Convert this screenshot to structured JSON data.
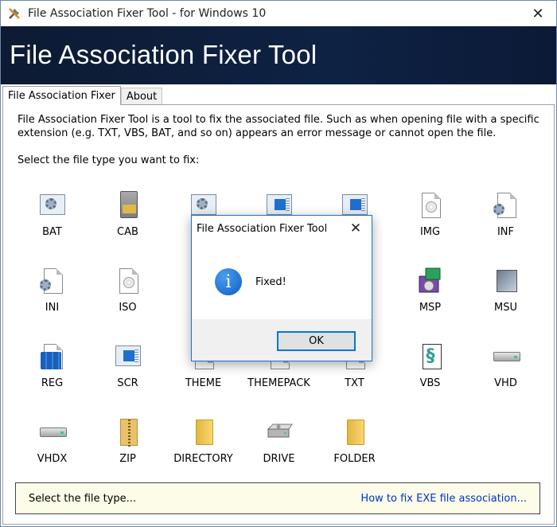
{
  "window": {
    "title": "File Association Fixer Tool - for Windows 10"
  },
  "banner": {
    "title": "File Association Fixer Tool"
  },
  "tabs": [
    {
      "label": "File Association Fixer",
      "active": true
    },
    {
      "label": "About",
      "active": false
    }
  ],
  "main": {
    "description": "File Association Fixer Tool is a tool to fix the associated file. Such as when opening file with a specific extension (e.g. TXT, VBS, BAT, and so on) appears an error message or cannot open the file.",
    "prompt": "Select the file type you want to fix:",
    "file_types": [
      {
        "label": "BAT",
        "icon": "batch-icon"
      },
      {
        "label": "CAB",
        "icon": "cabinet-icon"
      },
      {
        "label": "",
        "icon": "gear-window-icon"
      },
      {
        "label": "",
        "icon": "window-icon"
      },
      {
        "label": "",
        "icon": "window-icon"
      },
      {
        "label": "IMG",
        "icon": "disc-image-icon"
      },
      {
        "label": "INF",
        "icon": "gear-document-icon"
      },
      {
        "label": "INI",
        "icon": "gear-document-icon"
      },
      {
        "label": "ISO",
        "icon": "disc-image-icon"
      },
      {
        "label": "MSP",
        "icon": "installer-icon"
      },
      {
        "label": "MSU",
        "icon": "update-package-icon"
      },
      {
        "label": "REG",
        "icon": "registry-icon"
      },
      {
        "label": "SCR",
        "icon": "window-icon"
      },
      {
        "label": "THEME",
        "icon": "theme-icon"
      },
      {
        "label": "THEMEPACK",
        "icon": "themepack-icon"
      },
      {
        "label": "TXT",
        "icon": "text-icon"
      },
      {
        "label": "VBS",
        "icon": "script-icon"
      },
      {
        "label": "VHD",
        "icon": "drive-icon"
      },
      {
        "label": "VHDX",
        "icon": "drive-icon"
      },
      {
        "label": "ZIP",
        "icon": "zip-folder-icon"
      },
      {
        "label": "DIRECTORY",
        "icon": "folder-icon"
      },
      {
        "label": "DRIVE",
        "icon": "hard-drive-icon"
      },
      {
        "label": "FOLDER",
        "icon": "folder-icon"
      }
    ]
  },
  "statusbar": {
    "text": "Select the file type...",
    "link": "How to fix EXE file association..."
  },
  "dialog": {
    "title": "File Association Fixer Tool",
    "message": "Fixed!",
    "ok_label": "OK"
  },
  "colors": {
    "banner": "#0e2244",
    "accent": "#0078d7",
    "link": "#0033cc",
    "statusbar_bg": "#fcfce8"
  }
}
